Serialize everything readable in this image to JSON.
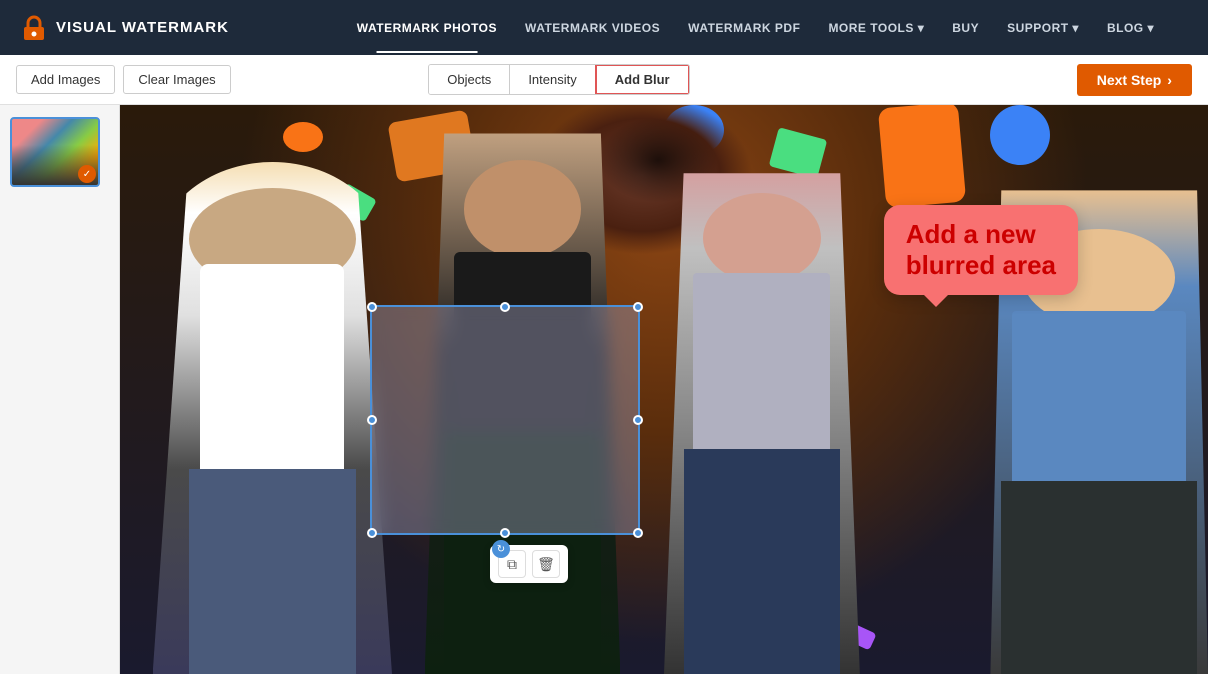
{
  "app": {
    "name": "VISUAL WATERMARK"
  },
  "header": {
    "logo_text": "VISUAL WATERMARK",
    "nav": [
      {
        "id": "watermark-photos",
        "label": "WATERMARK PHOTOS",
        "active": true
      },
      {
        "id": "watermark-videos",
        "label": "WATERMARK VIDEOS",
        "active": false
      },
      {
        "id": "watermark-pdf",
        "label": "WATERMARK PDF",
        "active": false
      },
      {
        "id": "more-tools",
        "label": "MORE TOOLS ▾",
        "active": false
      },
      {
        "id": "buy",
        "label": "BUY",
        "active": false
      },
      {
        "id": "support",
        "label": "SUPPORT ▾",
        "active": false
      },
      {
        "id": "blog",
        "label": "BLOG ▾",
        "active": false
      }
    ]
  },
  "toolbar": {
    "add_images_label": "Add Images",
    "clear_images_label": "Clear Images",
    "tabs": [
      {
        "id": "objects",
        "label": "Objects",
        "active": false
      },
      {
        "id": "intensity",
        "label": "Intensity",
        "active": false
      },
      {
        "id": "add-blur",
        "label": "Add Blur",
        "active": true
      }
    ],
    "next_step_label": "Next Step",
    "next_step_arrow": "›"
  },
  "tooltip": {
    "line1": "Add a new",
    "line2": "blurred area"
  },
  "blur_toolbar": {
    "duplicate_icon": "⧉",
    "delete_icon": "🗑"
  },
  "colors": {
    "header_bg": "#1e2a3a",
    "nav_text": "#cdd6e0",
    "next_step_bg": "#e05a00",
    "active_tab_border": "#e05555",
    "blur_box_border": "#4a90d9",
    "tooltip_bg": "#f87171",
    "tooltip_text_color": "#cc0000"
  }
}
